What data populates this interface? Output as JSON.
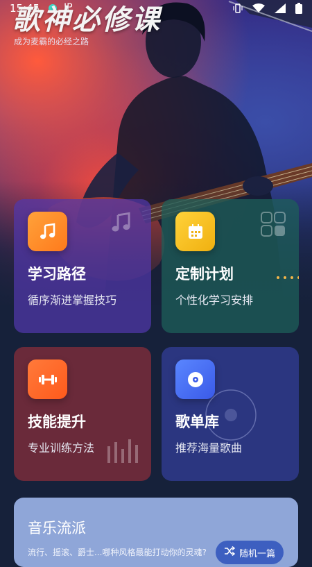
{
  "status_bar": {
    "time": "15:45",
    "ip_label": "IP"
  },
  "header": {
    "title": "歌神必修课",
    "subtitle": "成为麦霸的必经之路"
  },
  "cards": [
    {
      "title": "学习路径",
      "desc": "循序渐进掌握技巧",
      "icon": "music-note-icon"
    },
    {
      "title": "定制计划",
      "desc": "个性化学习安排",
      "icon": "calendar-icon"
    },
    {
      "title": "技能提升",
      "desc": "专业训练方法",
      "icon": "dumbbell-icon"
    },
    {
      "title": "歌单库",
      "desc": "推荐海量歌曲",
      "icon": "disc-icon"
    }
  ],
  "genre": {
    "title": "音乐流派",
    "desc": "流行、摇滚、爵士...哪种风格最能打动你的灵魂?",
    "button_label": "随机一篇"
  },
  "colors": {
    "learning_icon": "#ff8a25",
    "plan_icon": "#f5c11b",
    "skill_icon": "#ff6a2a",
    "playlist_icon": "#4a6cf5"
  }
}
